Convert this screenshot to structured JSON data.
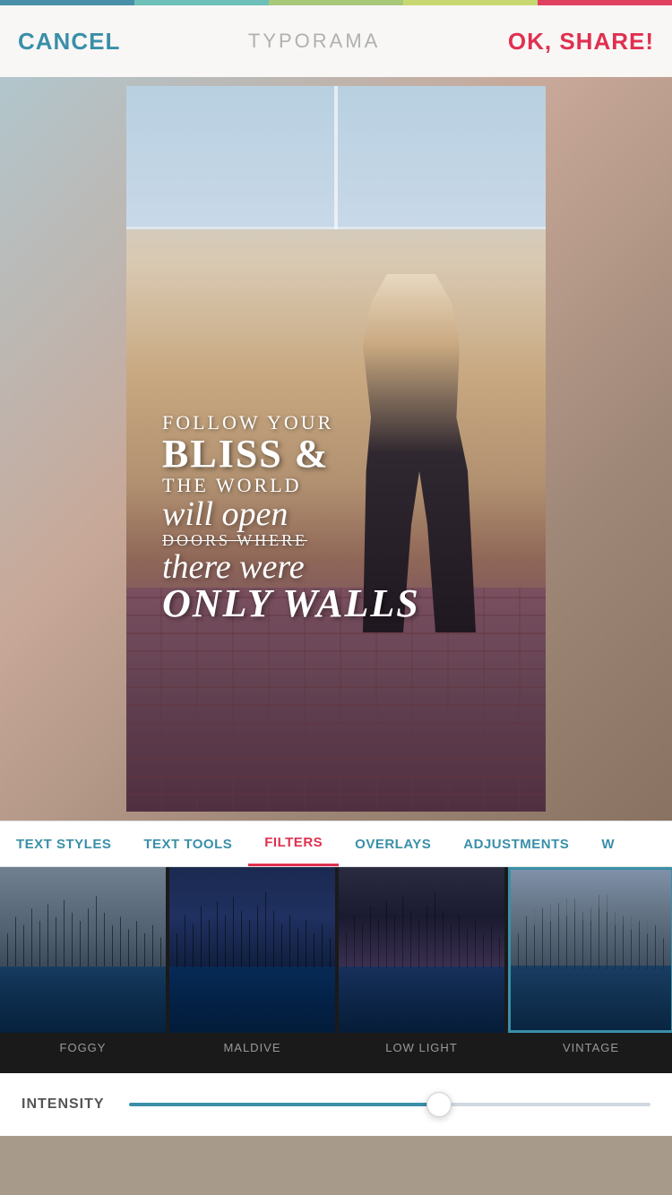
{
  "topColorBar": {
    "segments": [
      "teal",
      "cyan",
      "green",
      "yellow-green",
      "red"
    ]
  },
  "header": {
    "cancel_label": "CANCEL",
    "title": "TYPORAMA",
    "ok_share_label": "OK, SHARE!"
  },
  "quote": {
    "line1": "FOLLOW YOUR",
    "line2": "BLISS &",
    "line3": "THE WORLD",
    "line4": "will open",
    "line5": "DOORS WHERE",
    "line6": "there were",
    "line7": "ONLY WALLS"
  },
  "tabs": [
    {
      "id": "text-styles",
      "label": "TEXT STYLES",
      "active": false
    },
    {
      "id": "text-tools",
      "label": "TEXT TOOLS",
      "active": false
    },
    {
      "id": "filters",
      "label": "FILTERS",
      "active": true
    },
    {
      "id": "overlays",
      "label": "OVERLAYS",
      "active": false
    },
    {
      "id": "adjustments",
      "label": "ADJUSTMENTS",
      "active": false
    },
    {
      "id": "w",
      "label": "W",
      "active": false
    }
  ],
  "filters": [
    {
      "id": "foggy",
      "label": "FOGGY",
      "selected": false
    },
    {
      "id": "maldive",
      "label": "MALDIVE",
      "selected": false
    },
    {
      "id": "low-light",
      "label": "LOW LIGHT",
      "selected": false
    },
    {
      "id": "vintage",
      "label": "VINTAGE",
      "selected": true
    }
  ],
  "intensity": {
    "label": "INTENSITY",
    "value": 60
  }
}
